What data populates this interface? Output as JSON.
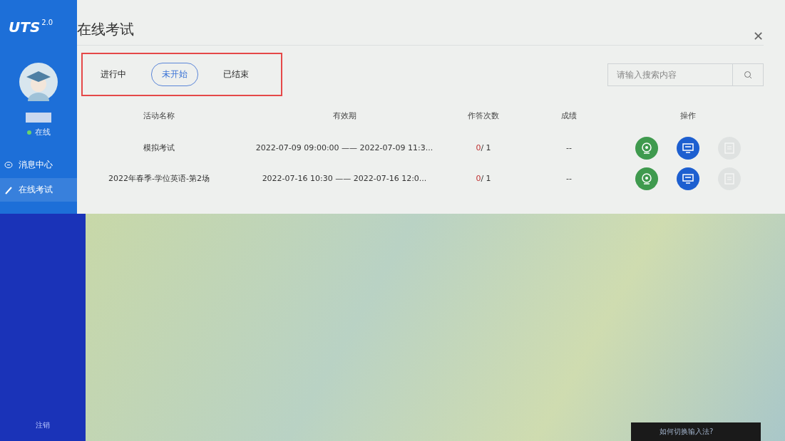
{
  "sidebar": {
    "logo": "UTS",
    "logo_version": "2.0",
    "status": "在线",
    "online": true,
    "items": [
      {
        "label": "消息中心",
        "kind": "message",
        "selected": false
      },
      {
        "label": "在线考试",
        "kind": "edit",
        "selected": true
      }
    ],
    "logout": "注销"
  },
  "panel": {
    "title": "在线考试",
    "close": "✕",
    "tabs": [
      {
        "label": "进行中",
        "selected": false
      },
      {
        "label": "未开始",
        "selected": true
      },
      {
        "label": "已结束",
        "selected": false
      }
    ],
    "search": {
      "placeholder": "请输入搜索内容"
    },
    "table": {
      "columns": [
        "活动名称",
        "有效期",
        "作答次数",
        "成绩",
        "操作"
      ],
      "rows": [
        {
          "name": "模拟考试",
          "period": "2022-07-09 09:00:00 —— 2022-07-09 11:3...",
          "attempts_used": "0",
          "attempts_total": "/ 1",
          "score": "--",
          "actions": [
            {
              "kind": "camera",
              "disabled": false
            },
            {
              "kind": "monitor",
              "disabled": false
            },
            {
              "kind": "document",
              "disabled": true
            }
          ]
        },
        {
          "name": "2022年春季-学位英语-第2场",
          "period": "2022-07-16 10:30 —— 2022-07-16 12:0...",
          "attempts_used": "0",
          "attempts_total": "/ 1",
          "score": "--",
          "actions": [
            {
              "kind": "camera",
              "disabled": false
            },
            {
              "kind": "monitor",
              "disabled": false
            },
            {
              "kind": "document",
              "disabled": true
            }
          ]
        }
      ]
    }
  },
  "ime_hint": "如何切换输入法?"
}
